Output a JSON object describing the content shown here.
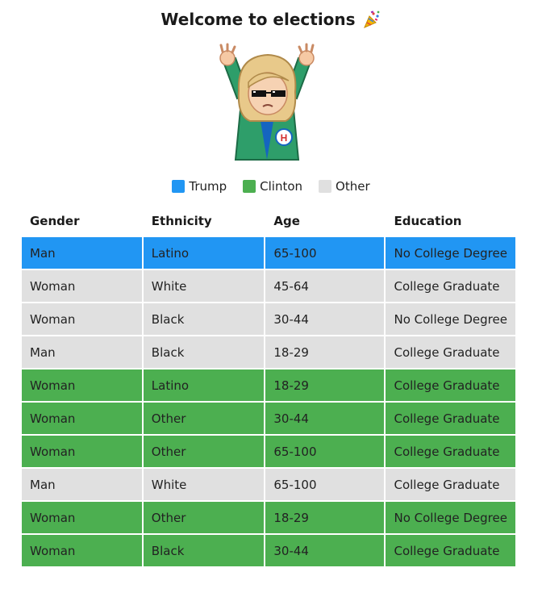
{
  "header": {
    "title": "Welcome to elections"
  },
  "avatar": {
    "icon": "cartoon-candidate-avatar-icon"
  },
  "legend": [
    {
      "label": "Trump",
      "color": "#2196f3"
    },
    {
      "label": "Clinton",
      "color": "#4caf50"
    },
    {
      "label": "Other",
      "color": "#e0e0e0"
    }
  ],
  "colors": {
    "Trump": "#2196f3",
    "Clinton": "#4caf50",
    "Other": "#e0e0e0"
  },
  "table": {
    "headers": [
      "Gender",
      "Ethnicity",
      "Age",
      "Education"
    ],
    "rows": [
      {
        "gender": "Man",
        "ethnicity": "Latino",
        "age": "65-100",
        "education": "No College Degree",
        "vote": "Trump"
      },
      {
        "gender": "Woman",
        "ethnicity": "White",
        "age": "45-64",
        "education": "College Graduate",
        "vote": "Other"
      },
      {
        "gender": "Woman",
        "ethnicity": "Black",
        "age": "30-44",
        "education": "No College Degree",
        "vote": "Other"
      },
      {
        "gender": "Man",
        "ethnicity": "Black",
        "age": "18-29",
        "education": "College Graduate",
        "vote": "Other"
      },
      {
        "gender": "Woman",
        "ethnicity": "Latino",
        "age": "18-29",
        "education": "College Graduate",
        "vote": "Clinton"
      },
      {
        "gender": "Woman",
        "ethnicity": "Other",
        "age": "30-44",
        "education": "College Graduate",
        "vote": "Clinton"
      },
      {
        "gender": "Woman",
        "ethnicity": "Other",
        "age": "65-100",
        "education": "College Graduate",
        "vote": "Clinton"
      },
      {
        "gender": "Man",
        "ethnicity": "White",
        "age": "65-100",
        "education": "College Graduate",
        "vote": "Other"
      },
      {
        "gender": "Woman",
        "ethnicity": "Other",
        "age": "18-29",
        "education": "No College Degree",
        "vote": "Clinton"
      },
      {
        "gender": "Woman",
        "ethnicity": "Black",
        "age": "30-44",
        "education": "College Graduate",
        "vote": "Clinton"
      }
    ]
  }
}
